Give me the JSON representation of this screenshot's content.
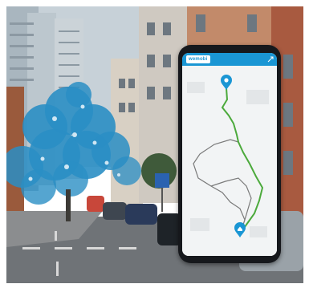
{
  "app": {
    "name": "wemobi",
    "brand_color": "#1a96d4",
    "route_color": "#4caa3c",
    "alt_route_color": "#7a7a7a"
  },
  "scene": {
    "tree_color": "#2a8ec4",
    "sky_color": "#c9d3da"
  },
  "icons": {
    "start_marker": "map-pin-icon",
    "end_marker": "home-pin-icon",
    "expand": "expand-icon"
  }
}
